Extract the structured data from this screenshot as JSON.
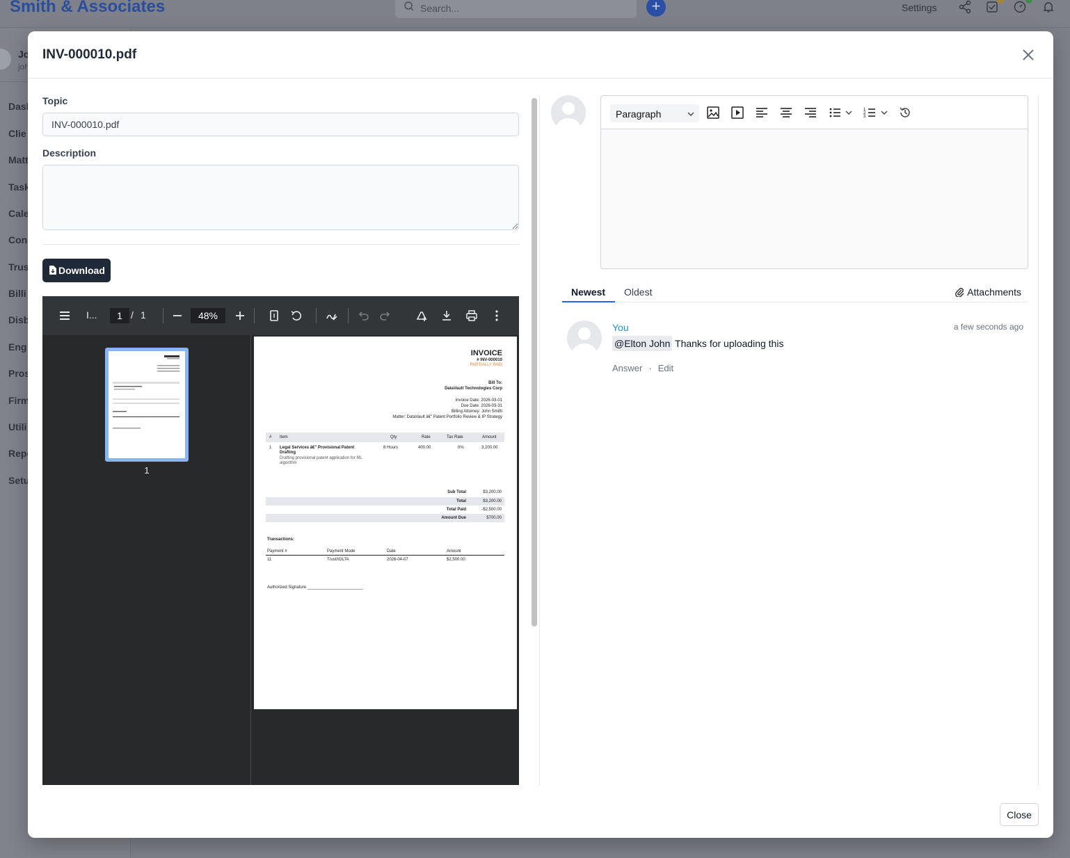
{
  "app": {
    "brand": "Smith & Associates",
    "search_placeholder": "Search...",
    "settings_label": "Settings",
    "user_name": "Jo",
    "user_email": "joh",
    "nav": [
      "Dasl",
      "Clie",
      "Matt",
      "Task",
      "Cale",
      "Con",
      "Trus",
      "Billi",
      "Disb",
      "Eng",
      "Pros",
      "Firm",
      "Utili",
      "Repo",
      "Setu"
    ]
  },
  "modal": {
    "title": "INV-000010.pdf",
    "topic_label": "Topic",
    "topic_value": "INV-000010.pdf",
    "description_label": "Description",
    "description_value": "",
    "download_label": "Download",
    "close_label": "Close"
  },
  "pdf_viewer": {
    "title_truncated": "I...",
    "current_page": "1",
    "page_separator": "/",
    "total_pages": "1",
    "zoom": "48%",
    "thumbnail_label": "1"
  },
  "invoice": {
    "heading": "INVOICE",
    "number": "# INV-000010",
    "status": "PARTIALLY PAID",
    "status_color": "#f0822a",
    "bill_to_label": "Bill To:",
    "bill_to": "DataVault Technologies Corp",
    "invoice_date": "Invoice Date: 2026-03-01",
    "due_date": "Due Date: 2026-03-31",
    "billing_attorney": "Billing Attorney: John Smith",
    "matter": "Matter: DataVault â€\" Patent Portfolio Review & IP Strategy",
    "table_headers": [
      "#",
      "Item",
      "Qty",
      "Rate",
      "Tax Rate",
      "Amount"
    ],
    "line_item": {
      "num": "1",
      "item": "Legal Services â€\" Provisional Patent",
      "item_cont": "Drafting",
      "desc": "Drafting provisional patent application for ML",
      "desc_cont": "algorithm",
      "qty": "8 Hours",
      "rate": "400.00",
      "tax": "0%",
      "amount": "3,200.00"
    },
    "totals": [
      {
        "label": "Sub Total",
        "value": "$3,200.00"
      },
      {
        "label": "Total",
        "value": "$3,200.00"
      },
      {
        "label": "Total Paid",
        "value": "-$2,500.00"
      },
      {
        "label": "Amount Due",
        "value": "$700.00"
      }
    ],
    "transactions_label": "Transactions:",
    "transaction_headers": [
      "Payment #",
      "Payment Mode",
      "Date",
      "Amount"
    ],
    "transaction": {
      "num": "11",
      "mode": "Trust/IOLTA",
      "date": "2026-04-07",
      "amount": "$2,500.00"
    },
    "signature": "Authorized Signature ________________________"
  },
  "editor": {
    "block_format": "Paragraph"
  },
  "comments": {
    "tab_newest": "Newest",
    "tab_oldest": "Oldest",
    "attachments_label": "Attachments",
    "items": [
      {
        "author": "You",
        "time": "a few seconds ago",
        "mention": "@Elton John",
        "text": "Thanks for uploading this",
        "answer_label": "Answer",
        "separator": "·",
        "edit_label": "Edit"
      }
    ]
  },
  "colors": {
    "accent": "#2563eb",
    "author_link": "#2490d8",
    "dark_button": "#1f2937"
  }
}
